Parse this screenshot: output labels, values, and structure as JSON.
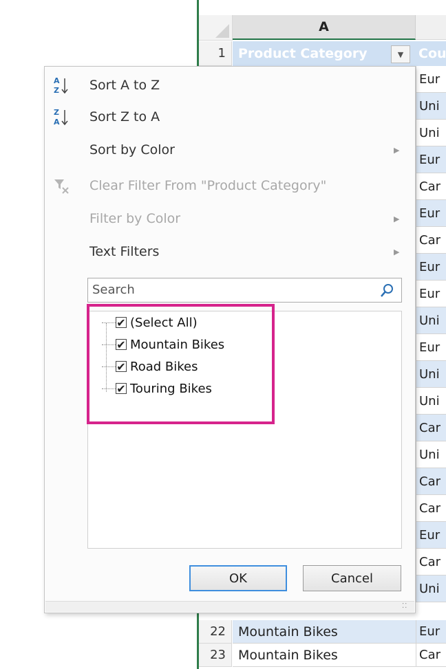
{
  "sheet": {
    "column_a": "A",
    "header_cell_a": "Product Category",
    "header_cell_b": "Cou",
    "row_1": "1",
    "column_b_cells": [
      "Eur",
      "Uni",
      "Uni",
      "Eur",
      "Car",
      "Eur",
      "Car",
      "Eur",
      "Eur",
      "Uni",
      "Eur",
      "Uni",
      "Uni",
      "Car",
      "Uni",
      "Car",
      "Car",
      "Eur",
      "Car",
      "Uni"
    ],
    "rows": [
      {
        "num": "22",
        "a": "Mountain Bikes",
        "b": "Eur"
      },
      {
        "num": "23",
        "a": "Mountain Bikes",
        "b": "Car"
      }
    ]
  },
  "menu": {
    "sort_az": "Sort A to Z",
    "sort_za": "Sort Z to A",
    "sort_by_color": "Sort by Color",
    "clear_filter": "Clear Filter From \"Product Category\"",
    "filter_by_color": "Filter by Color",
    "text_filters": "Text Filters",
    "search_placeholder": "Search",
    "items": [
      "(Select All)",
      "Mountain Bikes",
      "Road Bikes",
      "Touring Bikes"
    ],
    "ok": "OK",
    "cancel": "Cancel"
  },
  "colors": {
    "highlight_border": "#d6248c",
    "header_fill": "#cfe0f3",
    "ok_border": "#3e8ede"
  }
}
